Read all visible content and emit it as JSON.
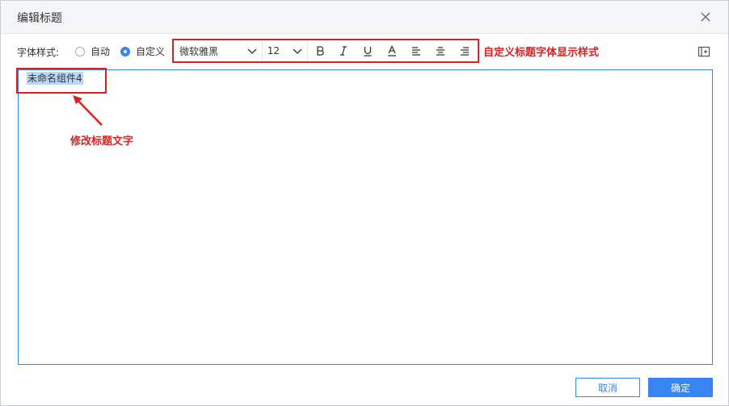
{
  "dialog": {
    "title": "编辑标题",
    "close_icon": "close-icon"
  },
  "toolbar": {
    "label": "字体样式:",
    "radio_auto": "自动",
    "radio_custom": "自定义",
    "selected_mode": "自定义",
    "font_family": "微软雅黑",
    "font_size": "12",
    "buttons": [
      "bold-icon",
      "italic-icon",
      "underline-icon",
      "font-color-icon",
      "align-left-icon",
      "align-center-icon",
      "align-right-icon"
    ],
    "expand_icon": "expand-icon"
  },
  "annotations": {
    "toolbar_note": "自定义标题字体显示样式",
    "editor_note": "修改标题文字"
  },
  "editor": {
    "text": "未命名组件4"
  },
  "footer": {
    "cancel_label": "取消",
    "ok_label": "确定"
  },
  "colors": {
    "accent": "#3685f2",
    "annotation_red": "#e02020",
    "selection": "#b9d7f7"
  }
}
